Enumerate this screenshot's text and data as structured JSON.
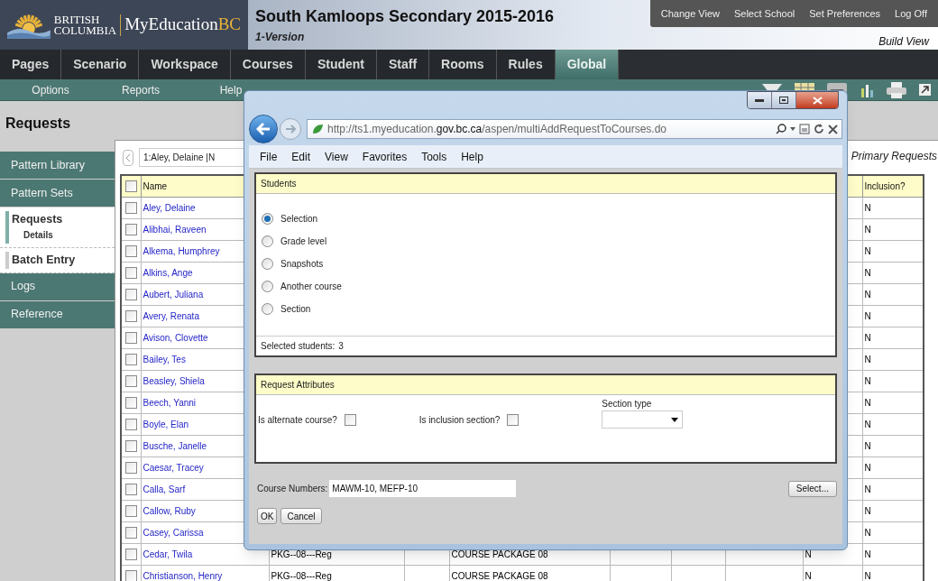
{
  "header": {
    "logo_line1": "BRITISH",
    "logo_line2": "COLUMBIA",
    "brand": "MyEducation",
    "brand_suffix": "BC",
    "title": "South Kamloops Secondary 2015-2016",
    "version": "1-Version",
    "top_links": [
      "Change View",
      "Select School",
      "Set Preferences",
      "Log Off"
    ],
    "view": "Build View"
  },
  "nav_tabs": [
    {
      "label": "Pages",
      "selected": false
    },
    {
      "label": "Scenario",
      "selected": false
    },
    {
      "label": "Workspace",
      "selected": false
    },
    {
      "label": "Courses",
      "selected": false
    },
    {
      "label": "Student",
      "selected": false
    },
    {
      "label": "Staff",
      "selected": false
    },
    {
      "label": "Rooms",
      "selected": false
    },
    {
      "label": "Rules",
      "selected": false
    },
    {
      "label": "Global",
      "selected": true
    }
  ],
  "sub_menu": [
    "Options",
    "Reports",
    "Help"
  ],
  "page_title": "Requests",
  "sidebar": [
    {
      "label": "Pattern Library",
      "kind": "tab"
    },
    {
      "label": "Pattern Sets",
      "kind": "tab"
    },
    {
      "label": "Requests",
      "kind": "page",
      "selected": true,
      "children": [
        {
          "label": "Details"
        }
      ]
    },
    {
      "label": "Batch Entry",
      "kind": "page",
      "selected": false
    },
    {
      "label": "Logs",
      "kind": "tab"
    },
    {
      "label": "Reference",
      "kind": "tab"
    }
  ],
  "record_selector": {
    "value": "1:Aley, Delaine |N"
  },
  "list_title": "Primary Requests",
  "table": {
    "header_checked": false,
    "columns": [
      "Name",
      "Inclusion?"
    ],
    "rows": [
      {
        "name": "Aley, Delaine",
        "checked": false,
        "inclusion": "N"
      },
      {
        "name": "Alibhai, Raveen",
        "checked": false,
        "inclusion": "N"
      },
      {
        "name": "Alkema, Humphrey",
        "checked": false,
        "inclusion": "N"
      },
      {
        "name": "Alkins, Ange",
        "checked": false,
        "inclusion": "N"
      },
      {
        "name": "Aubert, Juliana",
        "checked": false,
        "inclusion": "N"
      },
      {
        "name": "Avery, Renata",
        "checked": false,
        "inclusion": "N"
      },
      {
        "name": "Avison, Clovette",
        "checked": false,
        "inclusion": "N"
      },
      {
        "name": "Bailey, Tes",
        "checked": false,
        "inclusion": "N"
      },
      {
        "name": "Beasley, Shiela",
        "checked": false,
        "inclusion": "N"
      },
      {
        "name": "Beech, Yanni",
        "checked": false,
        "inclusion": "N"
      },
      {
        "name": "Boyle, Elan",
        "checked": false,
        "inclusion": "N"
      },
      {
        "name": "Busche, Janelle",
        "checked": false,
        "inclusion": "N"
      },
      {
        "name": "Caesar, Tracey",
        "checked": false,
        "inclusion": "N"
      },
      {
        "name": "Calla, Sarf",
        "checked": false,
        "inclusion": "N"
      },
      {
        "name": "Callow, Ruby",
        "checked": false,
        "inclusion": "N"
      },
      {
        "name": "Casey, Carissa",
        "checked": false,
        "inclusion": "N"
      },
      {
        "name": "Cedar, Twila",
        "checked": false,
        "code": "PKG--08---Reg",
        "description": "COURSE PACKAGE 08",
        "column_9": "N",
        "inclusion": "N"
      },
      {
        "name": "Christianson, Henry",
        "checked": false,
        "code": "PKG--08---Reg",
        "description": "COURSE PACKAGE 08",
        "column_9": "N",
        "inclusion": "N"
      }
    ]
  },
  "popup": {
    "address": "http://ts1.myeducation.**gov.bc.ca**/aspen/multiAddRequestToCourses.do",
    "menu": [
      "File",
      "Edit",
      "View",
      "Favorites",
      "Tools",
      "Help"
    ],
    "students": {
      "title": "Students",
      "options": [
        {
          "label": "Selection",
          "selected": true
        },
        {
          "label": "Grade level",
          "selected": false
        },
        {
          "label": "Snapshots",
          "selected": false
        },
        {
          "label": "Another course",
          "selected": false
        },
        {
          "label": "Section",
          "selected": false
        }
      ],
      "count_label": "Selected students:",
      "count": "3"
    },
    "attributes": {
      "title": "Request Attributes",
      "alternate": {
        "label": "Is alternate course?",
        "checked": false
      },
      "inclusion": {
        "label": "Is inclusion section?",
        "checked": false
      },
      "section_type": {
        "label": "Section type"
      }
    },
    "course_numbers": {
      "label": "Course Numbers:",
      "value": "MAWM-10, MEFP-10"
    },
    "buttons": {
      "select": "Select...",
      "ok": "OK",
      "cancel": "Cancel"
    }
  }
}
